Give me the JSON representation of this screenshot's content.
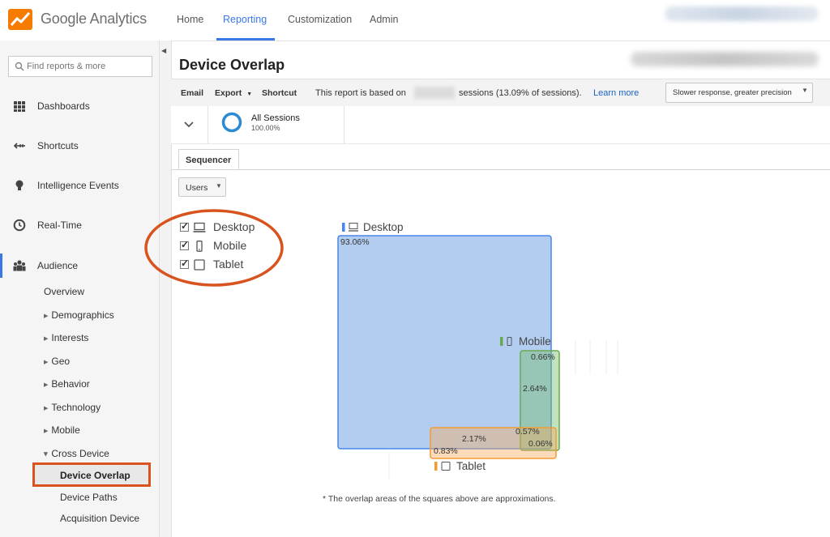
{
  "brand": {
    "product_name": "Google Analytics"
  },
  "top_nav": {
    "items": [
      {
        "label": "Home"
      },
      {
        "label": "Reporting"
      },
      {
        "label": "Customization"
      },
      {
        "label": "Admin"
      }
    ],
    "active": "Reporting"
  },
  "sidebar": {
    "search_placeholder": "Find reports & more",
    "items": [
      {
        "label": "Dashboards",
        "icon": "dashboards-grid-icon"
      },
      {
        "label": "Shortcuts",
        "icon": "shortcuts-arrow-icon"
      },
      {
        "label": "Intelligence Events",
        "icon": "lightbulb-icon"
      },
      {
        "label": "Real-Time",
        "icon": "clock-icon"
      },
      {
        "label": "Audience",
        "icon": "people-icon"
      }
    ],
    "audience_subitems": [
      {
        "label": "Overview"
      },
      {
        "label": "Demographics"
      },
      {
        "label": "Interests"
      },
      {
        "label": "Geo"
      },
      {
        "label": "Behavior"
      },
      {
        "label": "Technology"
      },
      {
        "label": "Mobile"
      },
      {
        "label": "Cross Device"
      }
    ],
    "cross_device_subitems": [
      {
        "label": "Device Overlap"
      },
      {
        "label": "Device Paths"
      },
      {
        "label": "Acquisition Device"
      }
    ],
    "active_item": "Device Overlap"
  },
  "report": {
    "title": "Device Overlap",
    "toolbar": {
      "email": "Email",
      "export": "Export",
      "shortcut": "Shortcut",
      "note_prefix": "This report is based on",
      "note_suffix": "sessions (13.09% of sessions).",
      "learn_more": "Learn more",
      "precision": "Slower response, greater precision"
    },
    "segment": {
      "name": "All Sessions",
      "percent": "100.00%"
    },
    "tab": "Sequencer",
    "metric_select": "Users",
    "devices": [
      {
        "label": "Desktop",
        "checked": true,
        "icon": "desktop-icon"
      },
      {
        "label": "Mobile",
        "checked": true,
        "icon": "mobile-icon"
      },
      {
        "label": "Tablet",
        "checked": true,
        "icon": "tablet-icon"
      }
    ],
    "footnote": "* The overlap areas of the squares above are approximations."
  },
  "colors": {
    "accent": "#3b78e7",
    "desktop": "#4a86e8",
    "mobile": "#6aa84f",
    "tablet": "#f39c33",
    "annotation": "#d9531e"
  },
  "chart_data": {
    "type": "venn-squares",
    "sets": [
      {
        "name": "Desktop",
        "only_value": "93.06%",
        "color": "#4a86e8"
      },
      {
        "name": "Mobile",
        "only_value": "0.66%",
        "color": "#6aa84f"
      },
      {
        "name": "Tablet",
        "only_value": "0.06%",
        "color": "#f39c33"
      }
    ],
    "overlaps": [
      {
        "sets": [
          "Desktop",
          "Mobile"
        ],
        "value": "2.64%"
      },
      {
        "sets": [
          "Desktop",
          "Tablet"
        ],
        "value": "2.17%"
      },
      {
        "sets": [
          "Desktop",
          "Mobile",
          "Tablet"
        ],
        "value": "0.57%"
      },
      {
        "sets": [
          "Tablet"
        ],
        "value": "0.83%"
      }
    ]
  }
}
